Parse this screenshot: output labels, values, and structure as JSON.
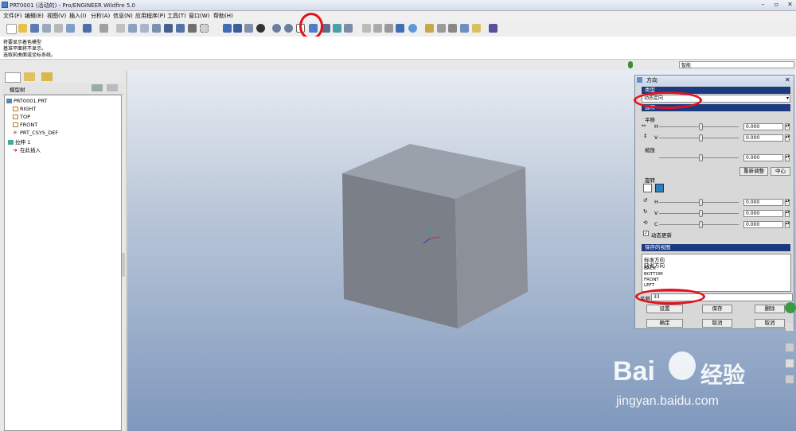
{
  "window": {
    "title": "PRT0001 (活动的) - Pro/ENGINEER Wildfire 5.0"
  },
  "menu": [
    "文件(F)",
    "编辑(E)",
    "视图(V)",
    "插入(I)",
    "分析(A)",
    "信息(N)",
    "应用程序(P)",
    "工具(T)",
    "窗口(W)",
    "帮助(H)"
  ],
  "messages": [
    "将要显示着色模型",
    "基准平面将不显示。",
    "选取前曲面或坐标系统。"
  ],
  "filter": {
    "value": "智能"
  },
  "leftpanel": {
    "tree_label": "模型树",
    "items": [
      "PRT0001.PRT",
      "RIGHT",
      "TOP",
      "FRONT",
      "PRT_CSYS_DEF",
      "拉伸 1",
      "在此插入"
    ]
  },
  "dialog": {
    "title": "方向",
    "type_section": "类型",
    "type_value": "动态定向",
    "options_section": "选项",
    "pan_label": "平移",
    "h_label": "H",
    "v_label": "V",
    "h_value": "0.000",
    "v_value": "0.000",
    "zoom_label": "缩放",
    "zoom_value": "0.000",
    "reset_button": "重新调整",
    "center_button": "中心",
    "rotate_label": "旋转",
    "c_label": "C",
    "rot_h_value": "0.000",
    "rot_v_value": "0.000",
    "rot_c_value": "0.000",
    "dynamic_update": "动态更新",
    "saved_views_section": "保存的视图",
    "saved_views": [
      "标准方向",
      "缺省方向",
      "BACK",
      "BOTTOM",
      "FRONT",
      "LEFT"
    ],
    "name_label": "名称",
    "name_value": "33",
    "set_button": "设置",
    "save_button": "保存",
    "delete_button": "删除",
    "ok_button": "确定",
    "cancel_button": "取消",
    "cancel_button2": "取消"
  },
  "watermark": {
    "brand": "Bai",
    "brand2": "经验",
    "url": "jingyan.baidu.com"
  }
}
